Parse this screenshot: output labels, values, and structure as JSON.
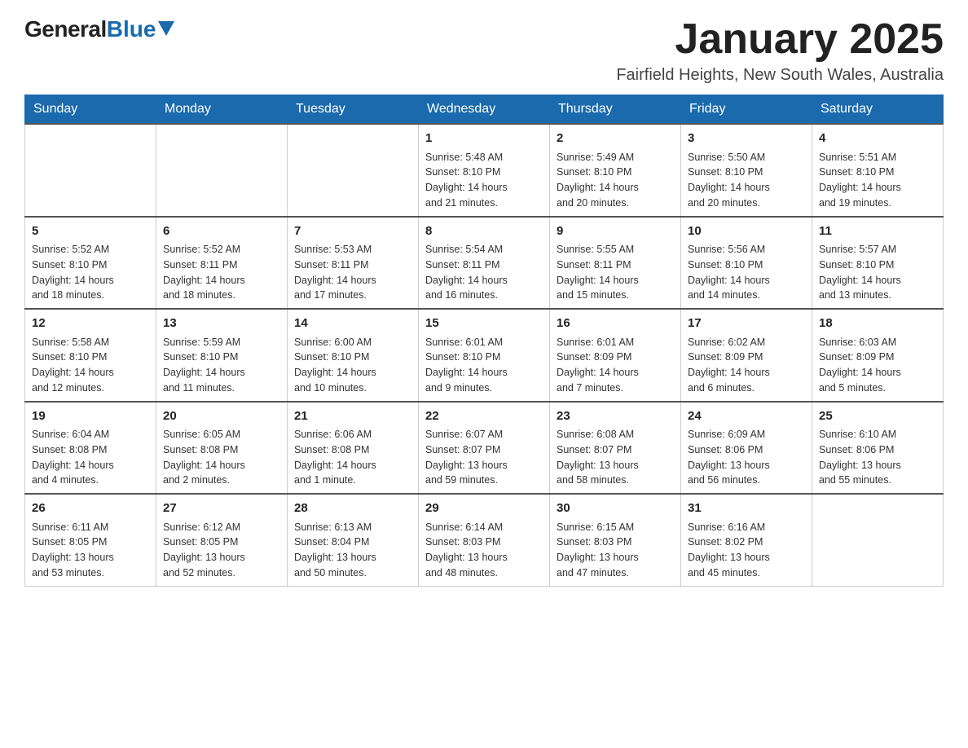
{
  "logo": {
    "general": "General",
    "blue": "Blue"
  },
  "title": "January 2025",
  "subtitle": "Fairfield Heights, New South Wales, Australia",
  "days_of_week": [
    "Sunday",
    "Monday",
    "Tuesday",
    "Wednesday",
    "Thursday",
    "Friday",
    "Saturday"
  ],
  "weeks": [
    [
      {
        "day": "",
        "info": ""
      },
      {
        "day": "",
        "info": ""
      },
      {
        "day": "",
        "info": ""
      },
      {
        "day": "1",
        "info": "Sunrise: 5:48 AM\nSunset: 8:10 PM\nDaylight: 14 hours\nand 21 minutes."
      },
      {
        "day": "2",
        "info": "Sunrise: 5:49 AM\nSunset: 8:10 PM\nDaylight: 14 hours\nand 20 minutes."
      },
      {
        "day": "3",
        "info": "Sunrise: 5:50 AM\nSunset: 8:10 PM\nDaylight: 14 hours\nand 20 minutes."
      },
      {
        "day": "4",
        "info": "Sunrise: 5:51 AM\nSunset: 8:10 PM\nDaylight: 14 hours\nand 19 minutes."
      }
    ],
    [
      {
        "day": "5",
        "info": "Sunrise: 5:52 AM\nSunset: 8:10 PM\nDaylight: 14 hours\nand 18 minutes."
      },
      {
        "day": "6",
        "info": "Sunrise: 5:52 AM\nSunset: 8:11 PM\nDaylight: 14 hours\nand 18 minutes."
      },
      {
        "day": "7",
        "info": "Sunrise: 5:53 AM\nSunset: 8:11 PM\nDaylight: 14 hours\nand 17 minutes."
      },
      {
        "day": "8",
        "info": "Sunrise: 5:54 AM\nSunset: 8:11 PM\nDaylight: 14 hours\nand 16 minutes."
      },
      {
        "day": "9",
        "info": "Sunrise: 5:55 AM\nSunset: 8:11 PM\nDaylight: 14 hours\nand 15 minutes."
      },
      {
        "day": "10",
        "info": "Sunrise: 5:56 AM\nSunset: 8:10 PM\nDaylight: 14 hours\nand 14 minutes."
      },
      {
        "day": "11",
        "info": "Sunrise: 5:57 AM\nSunset: 8:10 PM\nDaylight: 14 hours\nand 13 minutes."
      }
    ],
    [
      {
        "day": "12",
        "info": "Sunrise: 5:58 AM\nSunset: 8:10 PM\nDaylight: 14 hours\nand 12 minutes."
      },
      {
        "day": "13",
        "info": "Sunrise: 5:59 AM\nSunset: 8:10 PM\nDaylight: 14 hours\nand 11 minutes."
      },
      {
        "day": "14",
        "info": "Sunrise: 6:00 AM\nSunset: 8:10 PM\nDaylight: 14 hours\nand 10 minutes."
      },
      {
        "day": "15",
        "info": "Sunrise: 6:01 AM\nSunset: 8:10 PM\nDaylight: 14 hours\nand 9 minutes."
      },
      {
        "day": "16",
        "info": "Sunrise: 6:01 AM\nSunset: 8:09 PM\nDaylight: 14 hours\nand 7 minutes."
      },
      {
        "day": "17",
        "info": "Sunrise: 6:02 AM\nSunset: 8:09 PM\nDaylight: 14 hours\nand 6 minutes."
      },
      {
        "day": "18",
        "info": "Sunrise: 6:03 AM\nSunset: 8:09 PM\nDaylight: 14 hours\nand 5 minutes."
      }
    ],
    [
      {
        "day": "19",
        "info": "Sunrise: 6:04 AM\nSunset: 8:08 PM\nDaylight: 14 hours\nand 4 minutes."
      },
      {
        "day": "20",
        "info": "Sunrise: 6:05 AM\nSunset: 8:08 PM\nDaylight: 14 hours\nand 2 minutes."
      },
      {
        "day": "21",
        "info": "Sunrise: 6:06 AM\nSunset: 8:08 PM\nDaylight: 14 hours\nand 1 minute."
      },
      {
        "day": "22",
        "info": "Sunrise: 6:07 AM\nSunset: 8:07 PM\nDaylight: 13 hours\nand 59 minutes."
      },
      {
        "day": "23",
        "info": "Sunrise: 6:08 AM\nSunset: 8:07 PM\nDaylight: 13 hours\nand 58 minutes."
      },
      {
        "day": "24",
        "info": "Sunrise: 6:09 AM\nSunset: 8:06 PM\nDaylight: 13 hours\nand 56 minutes."
      },
      {
        "day": "25",
        "info": "Sunrise: 6:10 AM\nSunset: 8:06 PM\nDaylight: 13 hours\nand 55 minutes."
      }
    ],
    [
      {
        "day": "26",
        "info": "Sunrise: 6:11 AM\nSunset: 8:05 PM\nDaylight: 13 hours\nand 53 minutes."
      },
      {
        "day": "27",
        "info": "Sunrise: 6:12 AM\nSunset: 8:05 PM\nDaylight: 13 hours\nand 52 minutes."
      },
      {
        "day": "28",
        "info": "Sunrise: 6:13 AM\nSunset: 8:04 PM\nDaylight: 13 hours\nand 50 minutes."
      },
      {
        "day": "29",
        "info": "Sunrise: 6:14 AM\nSunset: 8:03 PM\nDaylight: 13 hours\nand 48 minutes."
      },
      {
        "day": "30",
        "info": "Sunrise: 6:15 AM\nSunset: 8:03 PM\nDaylight: 13 hours\nand 47 minutes."
      },
      {
        "day": "31",
        "info": "Sunrise: 6:16 AM\nSunset: 8:02 PM\nDaylight: 13 hours\nand 45 minutes."
      },
      {
        "day": "",
        "info": ""
      }
    ]
  ]
}
